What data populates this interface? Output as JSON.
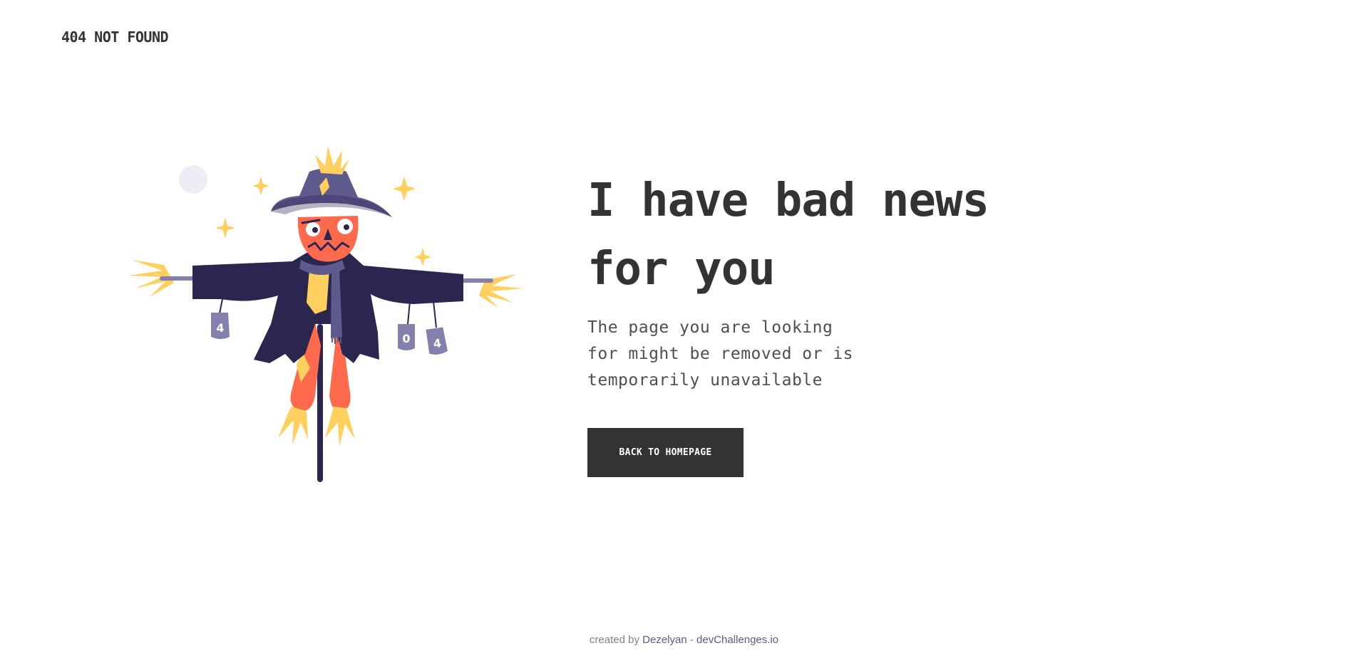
{
  "brand": {
    "label": "404 NOT FOUND"
  },
  "illustration": {
    "can_labels": [
      "4",
      "0",
      "4"
    ],
    "icon": "scarecrow-illustration"
  },
  "main": {
    "headline_line1": "I have bad news",
    "headline_line2": "for you",
    "description_line1": "The page you are looking",
    "description_line2": "for might be removed or is",
    "description_line3": "temporarily unavailable",
    "button_label": "BACK TO HOMEPAGE"
  },
  "footer": {
    "prefix": "created by",
    "author": "Dezelyan",
    "separator": "-",
    "site": "devChallenges.io"
  },
  "colors": {
    "text": "#333333",
    "button_bg": "#333333",
    "button_text": "#ffffff",
    "hat": "#5E5A8E",
    "coat": "#2B2650",
    "face": "#FF6A4D",
    "straw": "#FFD05E",
    "can": "#8480AE",
    "moon": "#ECEDF5"
  }
}
